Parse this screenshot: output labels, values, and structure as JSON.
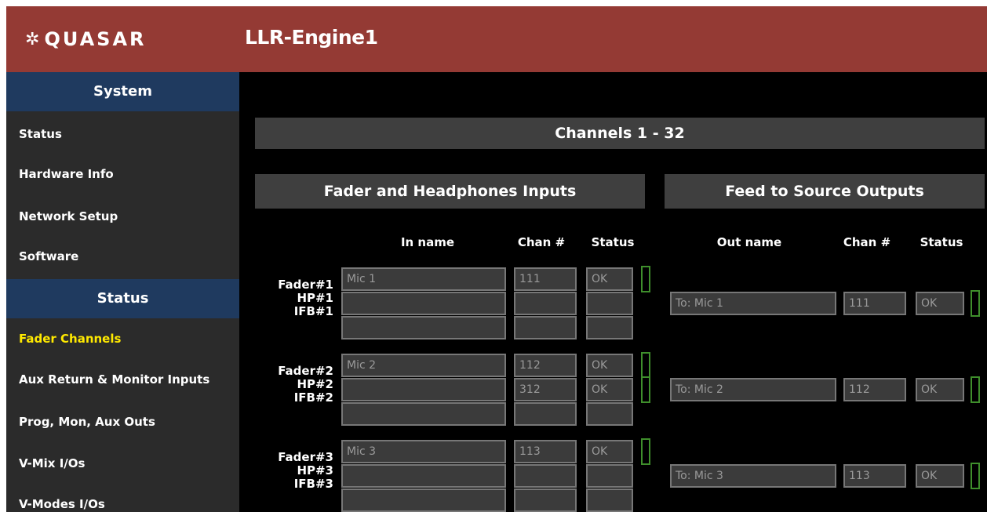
{
  "header": {
    "logo_text": "QUASAR",
    "logo_icon": "asterisk-star-icon",
    "title": "LLR-Engine1"
  },
  "sidebar": {
    "sections": [
      {
        "title": "System"
      },
      {
        "title": "Status"
      }
    ],
    "items": [
      {
        "label": "Status"
      },
      {
        "label": "Hardware Info"
      },
      {
        "label": "Network Setup"
      },
      {
        "label": "Software"
      },
      {
        "label": "Fader Channels"
      },
      {
        "label": "Aux Return & Monitor Inputs"
      },
      {
        "label": "Prog, Mon, Aux Outs"
      },
      {
        "label": "V-Mix I/Os"
      },
      {
        "label": "V-Modes I/Os"
      }
    ],
    "active_item": "Fader Channels"
  },
  "main": {
    "section_title": "Channels 1 - 32",
    "left_panel_title": "Fader and Headphones Inputs",
    "right_panel_title": "Feed to Source Outputs",
    "left_columns": {
      "name": "In name",
      "chan": "Chan #",
      "status": "Status"
    },
    "right_columns": {
      "name": "Out name",
      "chan": "Chan #",
      "status": "Status"
    },
    "groups": [
      {
        "rows": [
          {
            "label": "Fader#1",
            "name": "Mic 1",
            "chan": "111",
            "status": "OK"
          },
          {
            "label": "HP#1",
            "name": "",
            "chan": "",
            "status": ""
          },
          {
            "label": "IFB#1",
            "name": "",
            "chan": "",
            "status": ""
          }
        ],
        "output": {
          "name": "To: Mic 1",
          "chan": "111",
          "status": "OK"
        }
      },
      {
        "rows": [
          {
            "label": "Fader#2",
            "name": "Mic 2",
            "chan": "112",
            "status": "OK"
          },
          {
            "label": "HP#2",
            "name": "",
            "chan": "312",
            "status": "OK"
          },
          {
            "label": "IFB#2",
            "name": "",
            "chan": "",
            "status": ""
          }
        ],
        "output": {
          "name": "To: Mic 2",
          "chan": "112",
          "status": "OK"
        }
      },
      {
        "rows": [
          {
            "label": "Fader#3",
            "name": "Mic 3",
            "chan": "113",
            "status": "OK"
          },
          {
            "label": "HP#3",
            "name": "",
            "chan": "",
            "status": ""
          },
          {
            "label": "IFB#3",
            "name": "",
            "chan": "",
            "status": ""
          }
        ],
        "output": {
          "name": "To: Mic 3",
          "chan": "113",
          "status": "OK"
        }
      }
    ]
  },
  "colors": {
    "header": "#943a34",
    "sidebar_header": "#1f3a5f",
    "active_item": "#ffe900",
    "led_border": "#3f8f2c"
  }
}
